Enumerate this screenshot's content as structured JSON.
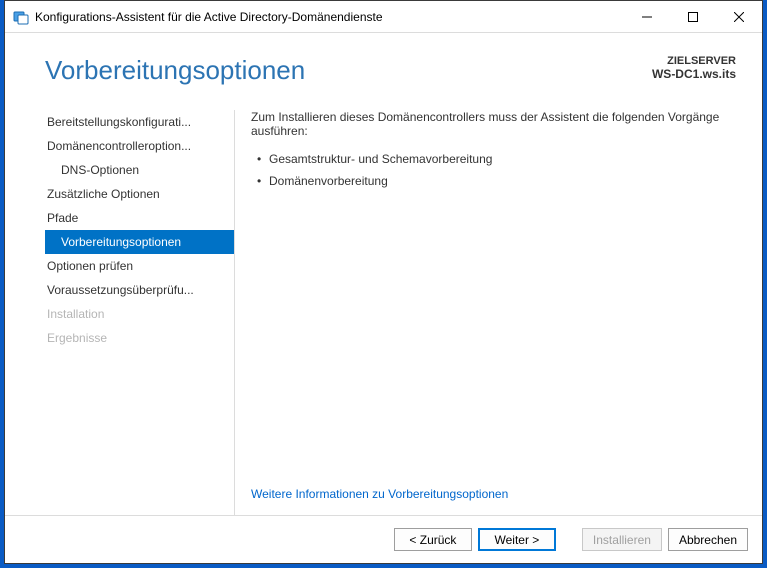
{
  "window": {
    "title": "Konfigurations-Assistent für die Active Directory-Domänendienste"
  },
  "header": {
    "title": "Vorbereitungsoptionen",
    "target_label": "ZIELSERVER",
    "target_value": "WS-DC1.ws.its"
  },
  "sidebar": {
    "items": [
      {
        "label": "Bereitstellungskonfigurati..."
      },
      {
        "label": "Domänencontrolleroption..."
      },
      {
        "label": "DNS-Optionen"
      },
      {
        "label": "Zusätzliche Optionen"
      },
      {
        "label": "Pfade"
      },
      {
        "label": "Vorbereitungsoptionen"
      },
      {
        "label": "Optionen prüfen"
      },
      {
        "label": "Voraussetzungsüberprüfu..."
      },
      {
        "label": "Installation"
      },
      {
        "label": "Ergebnisse"
      }
    ]
  },
  "main": {
    "intro": "Zum Installieren dieses Domänencontrollers muss der Assistent die folgenden Vorgänge ausführen:",
    "bullets": [
      "Gesamtstruktur- und Schemavorbereitung",
      "Domänenvorbereitung"
    ],
    "more_link": "Weitere Informationen zu Vorbereitungsoptionen"
  },
  "footer": {
    "back": "< Zurück",
    "next": "Weiter >",
    "install": "Installieren",
    "cancel": "Abbrechen"
  }
}
